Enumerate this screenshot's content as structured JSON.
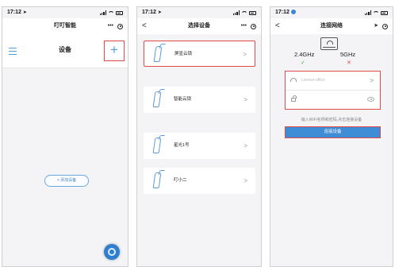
{
  "statusbar": {
    "phone1_time": "17:12",
    "phone2_time": "17:12",
    "phone3_time": "17:12"
  },
  "screen1": {
    "nav_title": "叮叮智能",
    "nav_more": "•••",
    "header_title": "设备",
    "add_symbol": "+",
    "add_device_label": "+ 添加设备"
  },
  "screen2": {
    "back": "<",
    "nav_title": "选择设备",
    "nav_more": "•••",
    "chevron": ">",
    "devices": [
      {
        "name": "屏显云锁",
        "selected": true
      },
      {
        "name": "智能云锁",
        "selected": false
      },
      {
        "name": "星光1号",
        "selected": false
      },
      {
        "name": "叮小二",
        "selected": false
      }
    ]
  },
  "screen3": {
    "back": "<",
    "nav_title": "连接网络",
    "band_24": "2.4GHz",
    "band_5": "5GHz",
    "band_24_status": "✓",
    "band_5_status": "✕",
    "ssid_value": "Lenovo-office",
    "chevron": ">",
    "hint": "输入WiFi名称和密码,点击连接设备",
    "connect_label": "连接设备"
  },
  "colors": {
    "accent_blue": "#3e8bd6",
    "highlight_red": "#e04a4a",
    "ok_green": "#42b06a"
  }
}
